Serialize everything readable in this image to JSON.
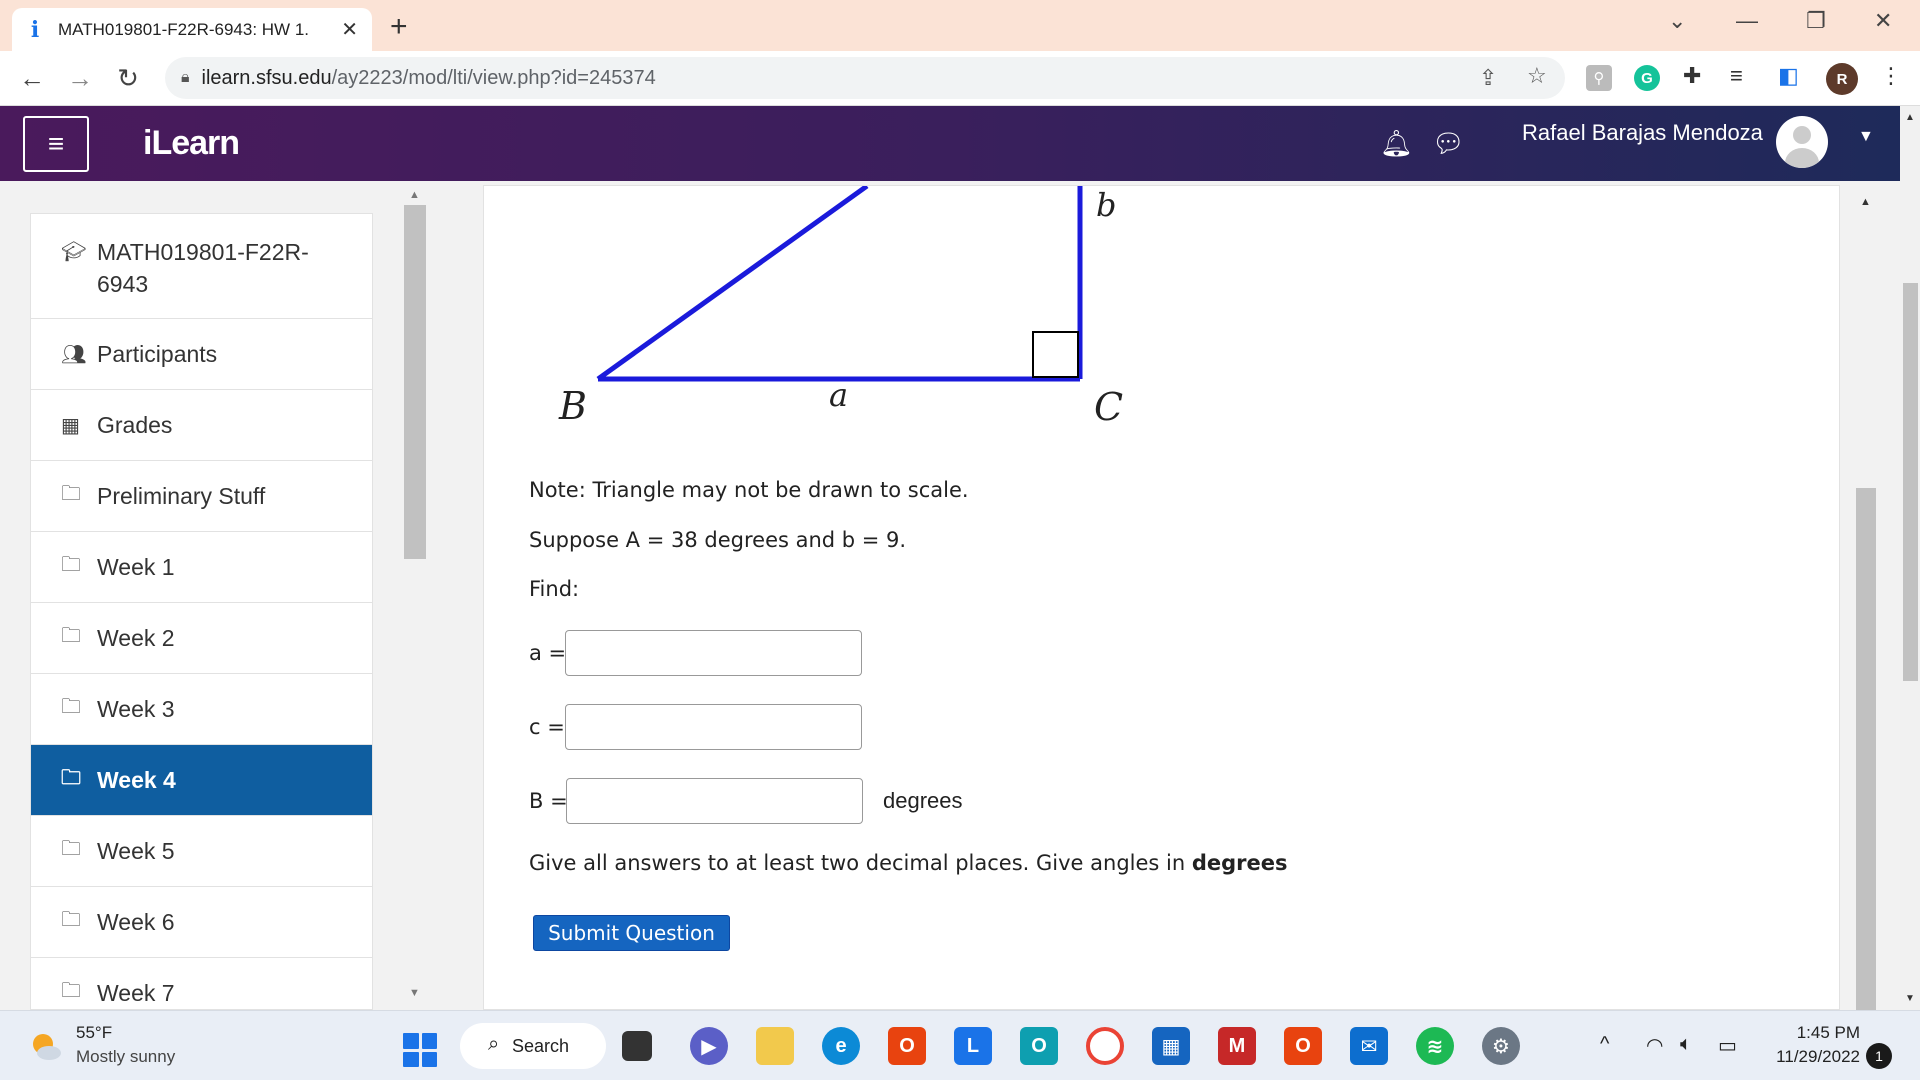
{
  "browser": {
    "tab_title": "MATH019801-F22R-6943: HW 1.",
    "url_domain": "ilearn.sfsu.edu",
    "url_path": "/ay2223/mod/lti/view.php?id=245374",
    "profile_initial": "R"
  },
  "header": {
    "brand": "iLearn",
    "username": "Rafael Barajas Mendoza"
  },
  "nav": {
    "items": [
      {
        "label": "MATH019801-F22R-6943",
        "icon": "graduation-cap-icon",
        "active": false
      },
      {
        "label": "Participants",
        "icon": "users-icon",
        "active": false
      },
      {
        "label": "Grades",
        "icon": "table-icon",
        "active": false
      },
      {
        "label": "Preliminary Stuff",
        "icon": "folder-icon",
        "active": false
      },
      {
        "label": "Week 1",
        "icon": "folder-icon",
        "active": false
      },
      {
        "label": "Week 2",
        "icon": "folder-icon",
        "active": false
      },
      {
        "label": "Week 3",
        "icon": "folder-icon",
        "active": false
      },
      {
        "label": "Week 4",
        "icon": "folder-icon",
        "active": true
      },
      {
        "label": "Week 5",
        "icon": "folder-icon",
        "active": false
      },
      {
        "label": "Week 6",
        "icon": "folder-icon",
        "active": false
      },
      {
        "label": "Week 7",
        "icon": "folder-icon",
        "active": false
      }
    ]
  },
  "question": {
    "vertex_b": "B",
    "vertex_c": "C",
    "side_a": "a",
    "side_b": "b",
    "note": "Note: Triangle may not be drawn to scale.",
    "given": "Suppose A = 38 degrees and b = 9.",
    "find": "Find:",
    "label_a": "a =",
    "label_c": "c =",
    "label_B": "B =",
    "units_B": "degrees",
    "instructions": "Give all answers to at least two decimal places. Give angles in",
    "instructions_bold": "degrees",
    "submit_label": "Submit Question",
    "value_a": "",
    "value_c": "",
    "value_B": ""
  },
  "taskbar": {
    "temperature": "55°F",
    "weather": "Mostly sunny",
    "search_label": "Search",
    "time": "1:45 PM",
    "date": "11/29/2022",
    "notification_count": "1"
  },
  "colors": {
    "triangle": "#1a1adb",
    "active_nav": "#0f5ea0",
    "submit": "#1565c0"
  }
}
